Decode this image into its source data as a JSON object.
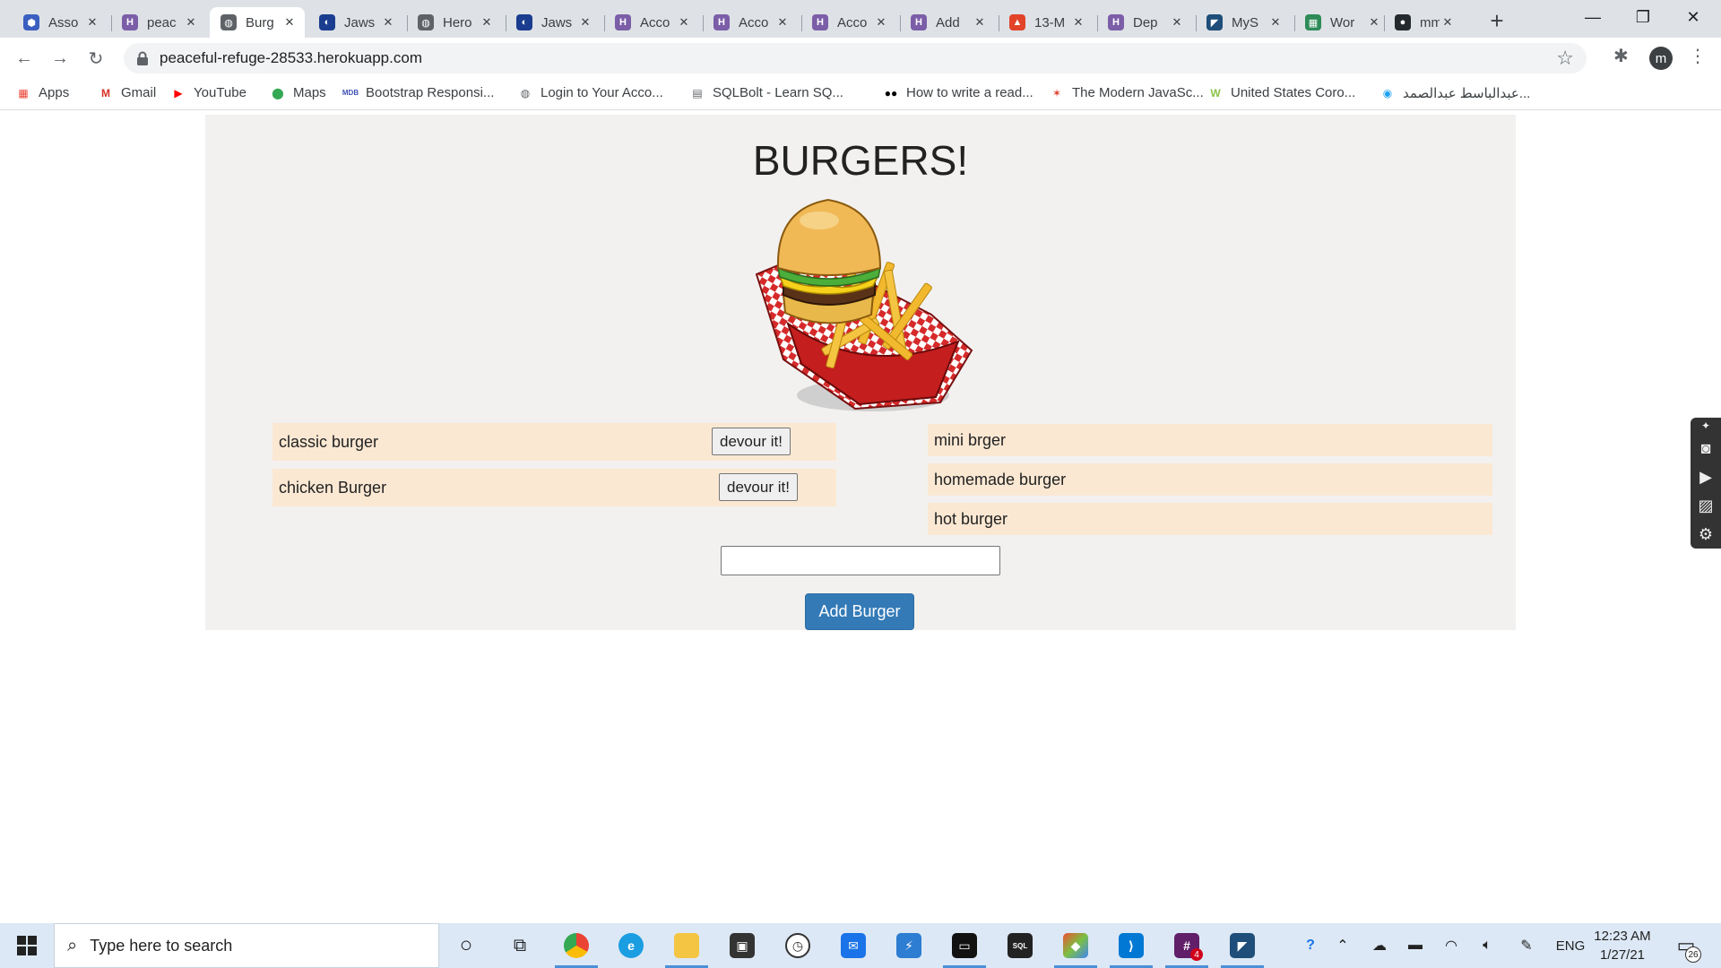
{
  "browser": {
    "tabs": [
      {
        "title": "Asso",
        "fav": "⬢",
        "color": "#3b5fc0"
      },
      {
        "title": "peac",
        "fav": "H",
        "color": "#7b5ea7"
      },
      {
        "title": "Burg",
        "fav": "◍",
        "color": "#5f6368",
        "active": true
      },
      {
        "title": "Jaws",
        "fav": "◐",
        "color": "#1a3d8f"
      },
      {
        "title": "Hero",
        "fav": "◍",
        "color": "#5f6368"
      },
      {
        "title": "Jaws",
        "fav": "◐",
        "color": "#1a3d8f"
      },
      {
        "title": "Acco",
        "fav": "H",
        "color": "#7b5ea7"
      },
      {
        "title": "Acco",
        "fav": "H",
        "color": "#7b5ea7"
      },
      {
        "title": "Acco",
        "fav": "H",
        "color": "#7b5ea7"
      },
      {
        "title": "Add",
        "fav": "H",
        "color": "#7b5ea7"
      },
      {
        "title": "13-M",
        "fav": "▲",
        "color": "#e24329"
      },
      {
        "title": "Dep",
        "fav": "H",
        "color": "#7b5ea7"
      },
      {
        "title": "MyS",
        "fav": "◤",
        "color": "#1e4e79"
      },
      {
        "title": "Wor",
        "fav": "▦",
        "color": "#2e8b57"
      },
      {
        "title": "mm",
        "fav": "●",
        "color": "#24292e"
      }
    ],
    "url": "peaceful-refuge-28533.herokuapp.com",
    "avatar_letter": "m",
    "bookmarks": [
      {
        "label": "Apps",
        "icon": "▦",
        "color": "#ea4335"
      },
      {
        "label": "Gmail",
        "icon": "M",
        "color": "#d93025"
      },
      {
        "label": "YouTube",
        "icon": "▶",
        "color": "#ff0000"
      },
      {
        "label": "Maps",
        "icon": "⬤",
        "color": "#34a853"
      },
      {
        "label": "Bootstrap Responsi...",
        "icon": "MDB",
        "color": "#3f51b5"
      },
      {
        "label": "Login to Your Acco...",
        "icon": "◍",
        "color": "#5f6368"
      },
      {
        "label": "SQLBolt - Learn SQ...",
        "icon": "▤",
        "color": "#5f6368"
      },
      {
        "label": "How to write a read...",
        "icon": "●●",
        "color": "#000000"
      },
      {
        "label": "The Modern JavaSc...",
        "icon": "✶",
        "color": "#e03b2c"
      },
      {
        "label": "United States Coro...",
        "icon": "W",
        "color": "#8bc34a"
      },
      {
        "label": "عبدالباسط عبدالصمد...",
        "icon": "◉",
        "color": "#1da1f2"
      }
    ]
  },
  "page": {
    "title": "BURGERS!",
    "not_devoured": [
      {
        "name": "classic burger",
        "button": "devour it!"
      },
      {
        "name": "chicken Burger",
        "button": "devour it!"
      }
    ],
    "devoured": [
      {
        "name": "mini brger"
      },
      {
        "name": "homemade burger"
      },
      {
        "name": "hot burger"
      }
    ],
    "input_value": "",
    "add_button": "Add Burger"
  },
  "taskbar": {
    "search_placeholder": "Type here to search",
    "language": "ENG",
    "time": "12:23 AM",
    "date": "1/27/21",
    "notification_count": "26",
    "slack_badge": "4"
  }
}
